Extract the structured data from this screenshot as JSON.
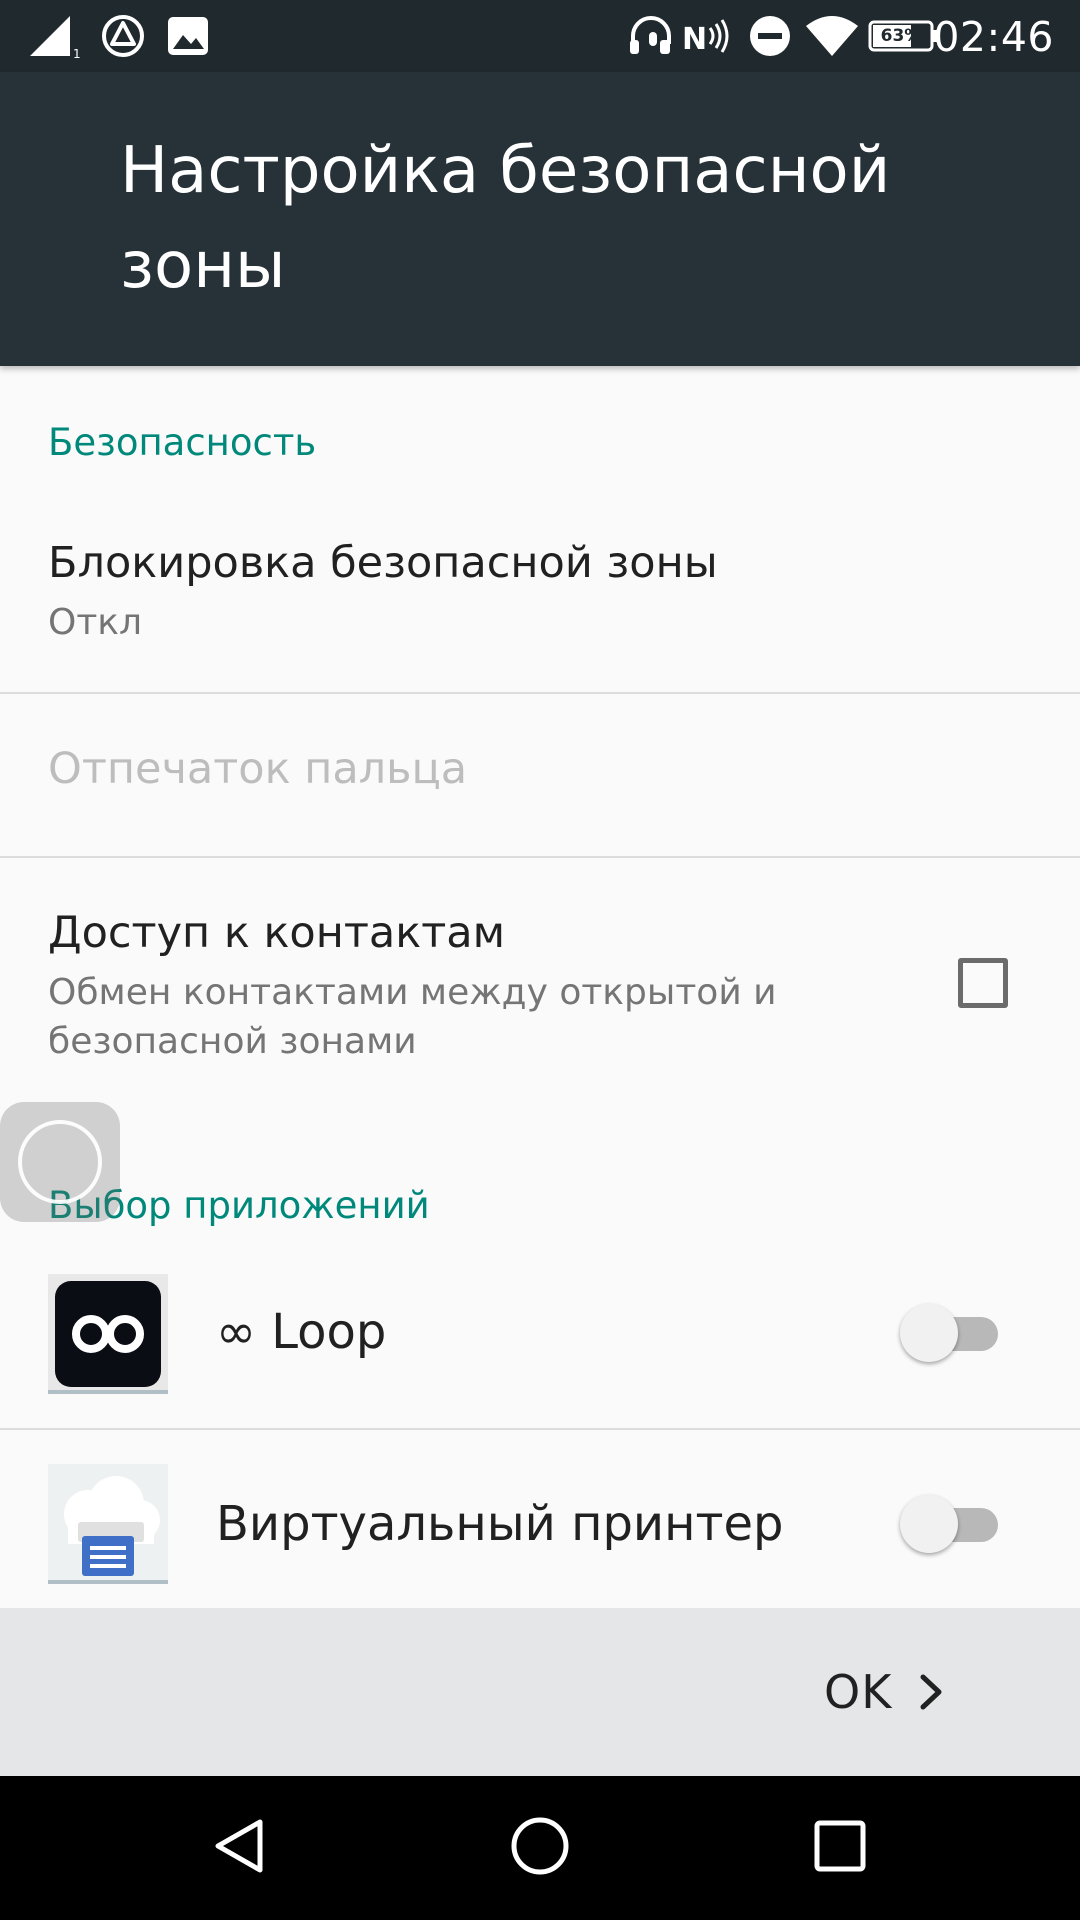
{
  "status_bar": {
    "time": "02:46",
    "battery": "63%",
    "icons": [
      "signal-icon",
      "sync-icon",
      "image-icon",
      "headset-icon",
      "nfc-icon",
      "do-not-disturb-icon",
      "wifi-icon",
      "battery-icon"
    ]
  },
  "app_bar": {
    "title": "Настройка безопасной зоны"
  },
  "security": {
    "header": "Безопасность",
    "lock": {
      "title": "Блокировка безопасной зоны",
      "summary": "Откл"
    },
    "fingerprint": {
      "title": "Отпечаток пальца",
      "enabled": false
    },
    "contacts": {
      "title": "Доступ к контактам",
      "summary": "Обмен контактами между открытой и безопасной зонами",
      "checked": false
    }
  },
  "apps": {
    "header": "Выбор приложений",
    "items": [
      {
        "label": "∞ Loop",
        "icon": "loop-app-icon",
        "enabled": false
      },
      {
        "label": "Виртуальный принтер",
        "icon": "cloud-print-app-icon",
        "enabled": false
      }
    ]
  },
  "actions": {
    "ok_label": "OK"
  },
  "nav": {
    "icons": [
      "back-icon",
      "home-icon",
      "recents-icon"
    ]
  },
  "colors": {
    "accent": "#00897b",
    "app_bar": "#263238",
    "status_bar": "#20292e",
    "action_bar": "#e4e6e7"
  }
}
